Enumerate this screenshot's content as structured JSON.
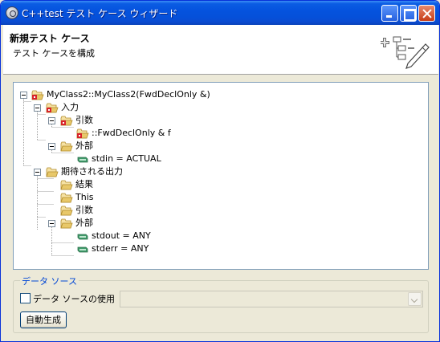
{
  "window": {
    "title": "C++test テスト ケース ウィザード"
  },
  "header": {
    "title": "新規テスト ケース",
    "description": "テスト ケースを構成"
  },
  "tree": {
    "nodes": [
      {
        "label": "MyClass2::MyClass2(FwdDeclOnly &)",
        "icon": "red-folder-icon",
        "expanded": true
      },
      {
        "label": "入力",
        "icon": "red-folder-icon",
        "expanded": true
      },
      {
        "label": "引数",
        "icon": "red-folder-icon",
        "expanded": true
      },
      {
        "label": "::FwdDeclOnly & f",
        "icon": "red-folder-icon"
      },
      {
        "label": "外部",
        "icon": "open-folder-icon",
        "expanded": true
      },
      {
        "label": "stdin = ACTUAL",
        "icon": "green-item-icon"
      },
      {
        "label": "期待される出力",
        "icon": "open-folder-icon",
        "expanded": true
      },
      {
        "label": "結果",
        "icon": "open-folder-icon"
      },
      {
        "label": "This",
        "icon": "open-folder-icon"
      },
      {
        "label": "引数",
        "icon": "open-folder-icon"
      },
      {
        "label": "外部",
        "icon": "open-folder-icon",
        "expanded": true
      },
      {
        "label": "stdout = ANY",
        "icon": "green-item-icon"
      },
      {
        "label": "stderr = ANY",
        "icon": "green-item-icon"
      }
    ]
  },
  "data_source": {
    "legend": "データ ソース",
    "checkbox_label": "データ ソースの使用",
    "checked": false,
    "select_value": "",
    "button_label": "自動生成"
  },
  "colors": {
    "titlebar": "#0553de",
    "legend_text": "#0046d5",
    "folder": "#e8c86a",
    "red_marker": "#d8232a",
    "green_item": "#3f9a6a"
  }
}
